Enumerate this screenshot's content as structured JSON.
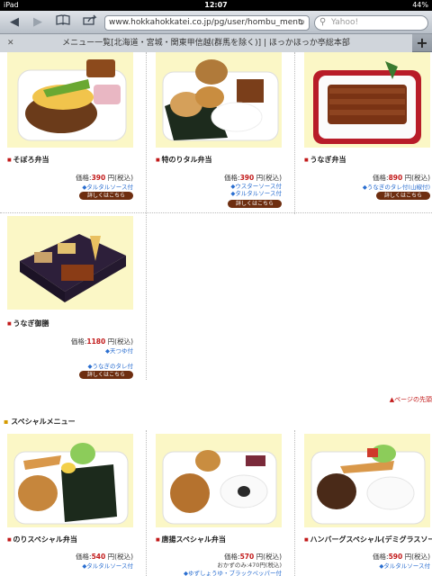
{
  "status": {
    "device": "iPad",
    "time": "12:07",
    "battery": "44%"
  },
  "browser": {
    "url": "www.hokkahokkatei.co.jp/pg/user/hombu_menu",
    "search_placeholder": "Yahoo!",
    "tab_title": "メニュー一覧[北海道・宮城・関東甲信越(群馬を除く)] | ほっかほっか亭総本部"
  },
  "items": [
    {
      "name": "そぼろ弁当",
      "price_label": "価格:",
      "price": "390",
      "price_suffix": "円(税込)",
      "notes": [
        "◆タルタルソース付"
      ],
      "detail": "詳しくはこちら"
    },
    {
      "name": "特のりタル弁当",
      "price_label": "価格:",
      "price": "390",
      "price_suffix": "円(税込)",
      "notes": [
        "◆ウスターソース付",
        "◆タルタルソース付"
      ],
      "detail": "詳しくはこちら"
    },
    {
      "name": "うなぎ弁当",
      "price_label": "価格:",
      "price": "890",
      "price_suffix": "円(税込)",
      "notes": [
        "◆うなぎのタレ付(山椒付)"
      ],
      "detail": "詳しくはこちら"
    },
    {
      "name": "うなぎ御膳",
      "price_label": "価格:",
      "price": "1180",
      "price_suffix": "円(税込)",
      "notes": [
        "◆天つゆ付",
        "◆うなぎのタレ付"
      ],
      "detail": "詳しくはこちら"
    }
  ],
  "page_top": "▲ページの先頭",
  "special_section": "スペシャルメニュー",
  "special_items": [
    {
      "name": "のりスペシャル弁当",
      "price_label": "価格:",
      "price": "540",
      "price_suffix": "円(税込)",
      "notes": [
        "◆タルタルソース付"
      ]
    },
    {
      "name": "唐揚スペシャル弁当",
      "price_label": "価格:",
      "price": "570",
      "price_suffix": "円(税込)",
      "notes": [
        "おかずのみ:470円(税込)",
        "◆ゆずしょうゆ・ブラックペッパー付"
      ]
    },
    {
      "name": "ハンバーグスペシャル(デミグラスソース)",
      "price_label": "価格:",
      "price": "590",
      "price_suffix": "円(税込)",
      "notes": [
        "◆タルタルソース付"
      ]
    }
  ]
}
